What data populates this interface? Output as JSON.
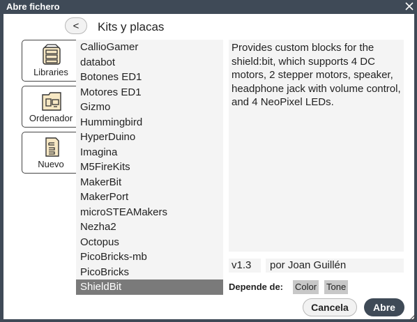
{
  "window": {
    "title": "Abre fichero",
    "close_icon": "close-icon"
  },
  "header": {
    "back_label": "<",
    "section_title": "Kits y placas"
  },
  "sidebar": {
    "items": [
      {
        "label": "Libraries",
        "icon": "books-icon"
      },
      {
        "label": "Ordenador",
        "icon": "folder-computer-icon"
      },
      {
        "label": "Nuevo",
        "icon": "new-project-icon"
      }
    ]
  },
  "list": {
    "items": [
      "CallioGamer",
      "databot",
      "Botones ED1",
      "Motores ED1",
      "Gizmo",
      "Hummingbird",
      "HyperDuino",
      "Imagina",
      "M5FireKits",
      "MakerBit",
      "MakerPort",
      "microSTEAMakers",
      "Nezha2",
      "Octopus",
      "PicoBricks-mb",
      "PicoBricks",
      "ShieldBit"
    ],
    "selected": "ShieldBit"
  },
  "details": {
    "description": "Provides custom blocks for the shield:bit, which supports 4 DC motors, 2 stepper motors, speaker, headphone jack with volume control, and 4 NeoPixel LEDs.",
    "version": "v1.3",
    "author": "por Joan Guillén",
    "depends_label": "Depende de:",
    "depends": [
      "Color",
      "Tone"
    ]
  },
  "footer": {
    "cancel_label": "Cancela",
    "open_label": "Abre"
  },
  "colors": {
    "accent": "#3f4a57",
    "selected_row": "#7a7a7a",
    "panel_bg": "#f4f4f4",
    "chip_bg": "#c8c8c8"
  }
}
